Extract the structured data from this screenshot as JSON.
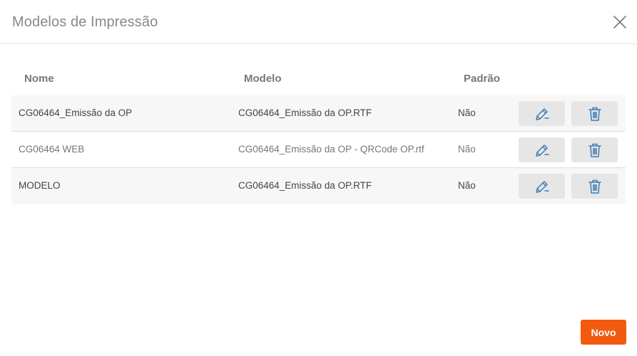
{
  "dialog": {
    "title": "Modelos de Impressão",
    "close_icon": "close-icon"
  },
  "table": {
    "headers": {
      "nome": "Nome",
      "modelo": "Modelo",
      "padrao": "Padrão"
    },
    "rows": [
      {
        "nome": "CG06464_Emissão da OP",
        "modelo": "CG06464_Emissão da OP.RTF",
        "padrao": "Não"
      },
      {
        "nome": "CG06464 WEB",
        "modelo": "CG06464_Emissão da OP - QRCode OP.rtf",
        "padrao": "Não"
      },
      {
        "nome": "MODELO",
        "modelo": "CG06464_Emissão da OP.RTF",
        "padrao": "Não"
      }
    ],
    "edit_icon": "pencil-icon",
    "delete_icon": "trash-icon"
  },
  "footer": {
    "novo_label": "Novo"
  },
  "colors": {
    "primary_button": "#f25a10",
    "icon_blue": "#3b7bb5",
    "action_button_bg": "#e6e6e6"
  }
}
